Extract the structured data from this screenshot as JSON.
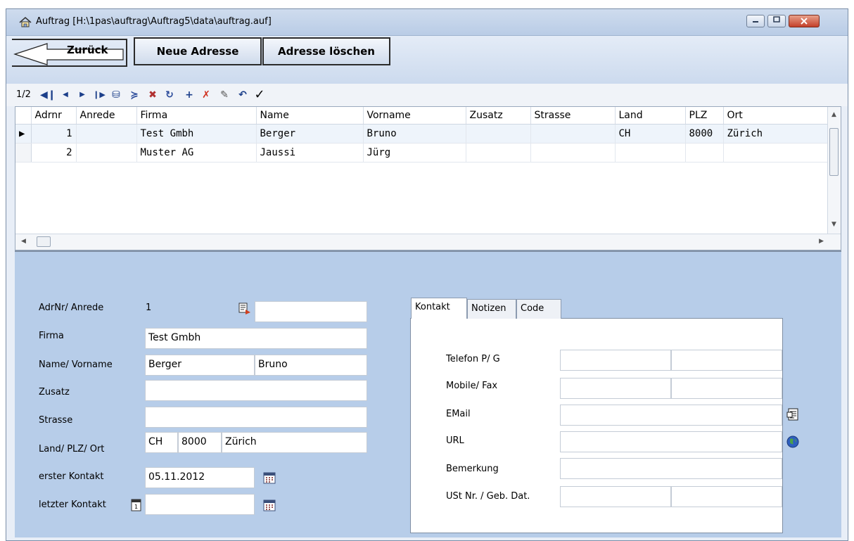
{
  "window": {
    "title": "Auftrag [H:\\1pas\\auftrag\\Auftrag5\\data\\auftrag.auf]"
  },
  "buttons": {
    "back": "Zurück",
    "new_address": "Neue Adresse",
    "delete_address": "Adresse löschen"
  },
  "navigator": {
    "position": "1/2"
  },
  "grid": {
    "columns": [
      "Adrnr",
      "Anrede",
      "Firma",
      "Name",
      "Vorname",
      "Zusatz",
      "Strasse",
      "Land",
      "PLZ",
      "Ort"
    ],
    "rows": [
      {
        "adrnr": "1",
        "anrede": "",
        "firma": "Test Gmbh",
        "name": "Berger",
        "vorname": "Bruno",
        "zusatz": "",
        "strasse": "",
        "land": "CH",
        "plz": "8000",
        "ort": "Zürich"
      },
      {
        "adrnr": "2",
        "anrede": "",
        "firma": "Muster AG",
        "name": "Jaussi",
        "vorname": "Jürg",
        "zusatz": "",
        "strasse": "",
        "land": "",
        "plz": "",
        "ort": ""
      }
    ]
  },
  "form": {
    "labels": {
      "adrnr_anrede": "AdrNr/ Anrede",
      "firma": "Firma",
      "name_vorname": "Name/ Vorname",
      "zusatz": "Zusatz",
      "strasse": "Strasse",
      "land_plz_ort": "Land/ PLZ/ Ort",
      "erster_kontakt": "erster Kontakt",
      "letzter_kontakt": "letzter Kontakt"
    },
    "values": {
      "adrnr": "1",
      "anrede": "",
      "firma": "Test Gmbh",
      "name": "Berger",
      "vorname": "Bruno",
      "zusatz": "",
      "strasse": "",
      "land": "CH",
      "plz": "8000",
      "ort": "Zürich",
      "erster_kontakt": "05.11.2012",
      "letzter_kontakt": ""
    }
  },
  "tabs": {
    "items": [
      "Kontakt",
      "Notizen",
      "Code"
    ],
    "active": "Kontakt",
    "kontakt": {
      "telefon": "Telefon P/ G",
      "mobile_fax": "Mobile/ Fax",
      "email": "EMail",
      "url": "URL",
      "bemerkung": "Bemerkung",
      "ust": "USt Nr. / Geb. Dat."
    }
  }
}
